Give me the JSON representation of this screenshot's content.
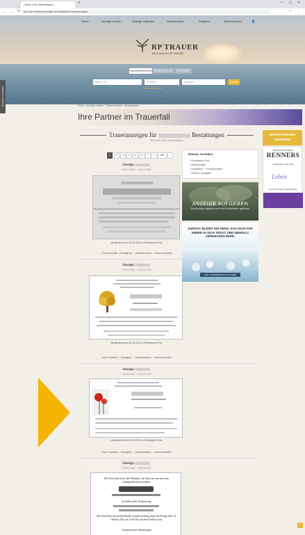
{
  "browser": {
    "tab_title": "Home | Die Gemeinsam...",
    "url": "rp-trauer.de/traueranzeigen-suche/aktuelle-traueranzeigen",
    "new_tab": "+",
    "window_controls": "— ▢ ✕",
    "nav": "← → ⟳",
    "icons": "☆ ⋮"
  },
  "nav": {
    "items": [
      "Home",
      "Anzeige suchen",
      "Anzeige aufgeben",
      "Gedenkseiten",
      "Ratgeber",
      "Branchenbuch"
    ],
    "user_icon": "👤"
  },
  "brand": {
    "name": "RP TRAUER",
    "tagline": "Ein Portal von RP ONLINE"
  },
  "search": {
    "tabs": [
      "TRAUERANZEIGEN",
      "GEDENKSEITEN",
      "RATGEBER"
    ],
    "name_placeholder": "Name, Ort",
    "time_placeholder": "Zeitraum",
    "edition_placeholder": "Ausgabe",
    "button": "Suchen",
    "advanced": "Erweiterte Suche"
  },
  "side_tab": "ANZEIGE AUFGEBEN",
  "breadcrumb": "Home › Anzeige suchen › Traueranzeigen › Bestattungen",
  "banner": {
    "title": "Ihre Partner im Trauerfall"
  },
  "page": {
    "heading_prefix": "Traueranzeigen für",
    "heading_suffix": "Bestattungen",
    "subheading": "Hier finden Sie Traueranzeigen"
  },
  "pagination": {
    "pages": [
      "1",
      "2",
      "3",
      "4",
      "5",
      "6",
      "7",
      "»",
      "Alle",
      "›"
    ]
  },
  "obituaries": [
    {
      "label": "Anzeige",
      "dates": "* 00.00.1934 – † 00.10.2022",
      "published": "veröffentlicht am 15.10.2022 in Rheinische Post",
      "actions": [
        "Zum Trauerfall",
        "Anzeige (1)",
        "Kondolenzbuch",
        "Kerze anzünden"
      ]
    },
    {
      "label": "Anzeige",
      "dates": "* 00.00.1939 – † 00.10.2022",
      "published": "veröffentlicht am 08.10.2022 in Rheinische Post",
      "actions": [
        "zum Trauerfall",
        "Anzeige(n)",
        "Kondolenzbuch",
        "Kerze anzünden"
      ]
    },
    {
      "label": "Anzeige",
      "dates": "* 00.00.1937 – † 00.10.2022",
      "published": "veröffentlicht am 01.10.2022 in Rheinische Post",
      "actions": [
        "zum Trauerfall",
        "Anzeige(n)",
        "Kondolenzbuch",
        "Kerze anzünden"
      ]
    },
    {
      "label": "Anzeige",
      "dates": "* 00.00.1940 – † 00.10.2022",
      "notice_text": "Die Zeit heilt nicht alle Wunden, sie lehrt uns nur mit dem Unbegreiflichen zu leben.",
      "notice_mid": "In liebevoller Erinnerung",
      "notice_end": "Die Trauerfeier mit anschließender Urnenbeisetzung findet am Freitag, dem 14. Oktober 2022 um 12.00 Uhr auf dem Friedhof statt.",
      "notice_last": "Traueranschrift: Bestattungen"
    }
  ],
  "sidebar": {
    "title": "Beliebte Suchfilter",
    "filters": [
      "› Rheinische Post",
      "› Bestattungen",
      "› Düsseldorf - Traueranzeigen",
      "› Suche in Ausgabe"
    ],
    "promo1_title": "ANZEIGE AUFGEBEN",
    "promo1_sub": "Eine Anzeige aufgeben und Ihren Verstorbenen gedenken",
    "promo2_title": "ZURÜCK BLEIBT EIN HERZ, DAS DICH FÜR IMMER IN SICH TRÄGT UND NIEMALS VERGESSEN WIRD.",
    "promo2_btn": "ZUR TRAUERSPRUCH-GALERIE"
  },
  "ads": {
    "ad1_line1": "BESTATTUNGEN",
    "ad1_line2": "REINDERS",
    "ad2_small": "BESTATTUNGSHAUS",
    "ad2_big": "RENNERS",
    "ad2_sub": "Zuverlässig an Ihrer Seite",
    "ad2_script": "Leben",
    "ad2_foot": "Ein Ort für Trauer und Erinnerung"
  },
  "colors": {
    "accent": "#e7b93a",
    "purple": "#6b3fa0"
  }
}
